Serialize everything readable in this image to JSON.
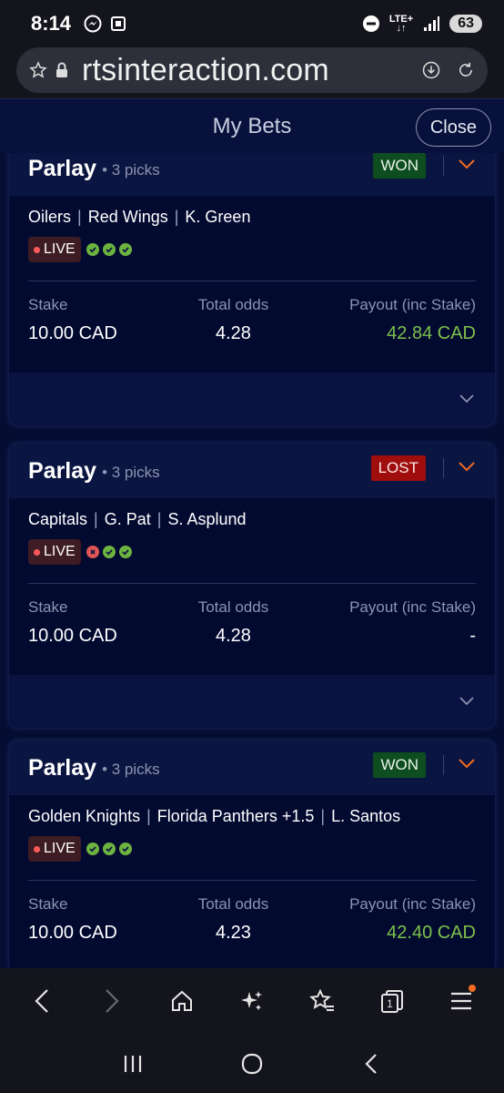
{
  "status_bar": {
    "time": "8:14",
    "network": "LTE+",
    "battery": "63",
    "icons": [
      "messenger-icon",
      "screenshot-icon",
      "dnd-icon",
      "signal-icon"
    ]
  },
  "browser": {
    "url": "rtsinteraction.com",
    "icons": [
      "star-icon",
      "lock-icon",
      "download-icon",
      "refresh-icon"
    ]
  },
  "app": {
    "title": "My Bets",
    "close_label": "Close"
  },
  "bets": [
    {
      "type": "Parlay",
      "picks": "• 3 picks",
      "status": "WON",
      "legs": [
        "Oilers",
        "Red Wings",
        "K. Green"
      ],
      "live_label": "LIVE",
      "results": [
        "ok",
        "ok",
        "ok"
      ],
      "stake_label": "Stake",
      "stake": "10.00 CAD",
      "odds_label": "Total odds",
      "odds": "4.28",
      "payout_label": "Payout (inc Stake)",
      "payout": "42.84 CAD"
    },
    {
      "type": "Parlay",
      "picks": "• 3 picks",
      "status": "LOST",
      "legs": [
        "Capitals",
        "G. Pat",
        "S. Asplund"
      ],
      "live_label": "LIVE",
      "results": [
        "x",
        "ok",
        "ok"
      ],
      "stake_label": "Stake",
      "stake": "10.00 CAD",
      "odds_label": "Total odds",
      "odds": "4.28",
      "payout_label": "Payout (inc Stake)",
      "payout": "-"
    },
    {
      "type": "Parlay",
      "picks": "• 3 picks",
      "status": "WON",
      "legs": [
        "Golden Knights",
        "Florida Panthers +1.5",
        "L. Santos"
      ],
      "live_label": "LIVE",
      "results": [
        "ok",
        "ok",
        "ok"
      ],
      "stake_label": "Stake",
      "stake": "10.00 CAD",
      "odds_label": "Total odds",
      "odds": "4.23",
      "payout_label": "Payout (inc Stake)",
      "payout": "42.40 CAD"
    }
  ],
  "browser_nav": {
    "tab_count": "1",
    "icons": [
      "back-icon",
      "forward-icon",
      "home-icon",
      "sparkle-icon",
      "bookmarks-icon",
      "tabs-icon",
      "menu-icon"
    ]
  },
  "system_nav": [
    "recents-icon",
    "home-circle-icon",
    "back-nav-icon"
  ],
  "colors": {
    "app_bg": "#050d33",
    "won_bg": "#0e4d1f",
    "lost_bg": "#a00d0d",
    "payout_won": "#7cc04b",
    "accent_chevron": "#f26b21"
  }
}
